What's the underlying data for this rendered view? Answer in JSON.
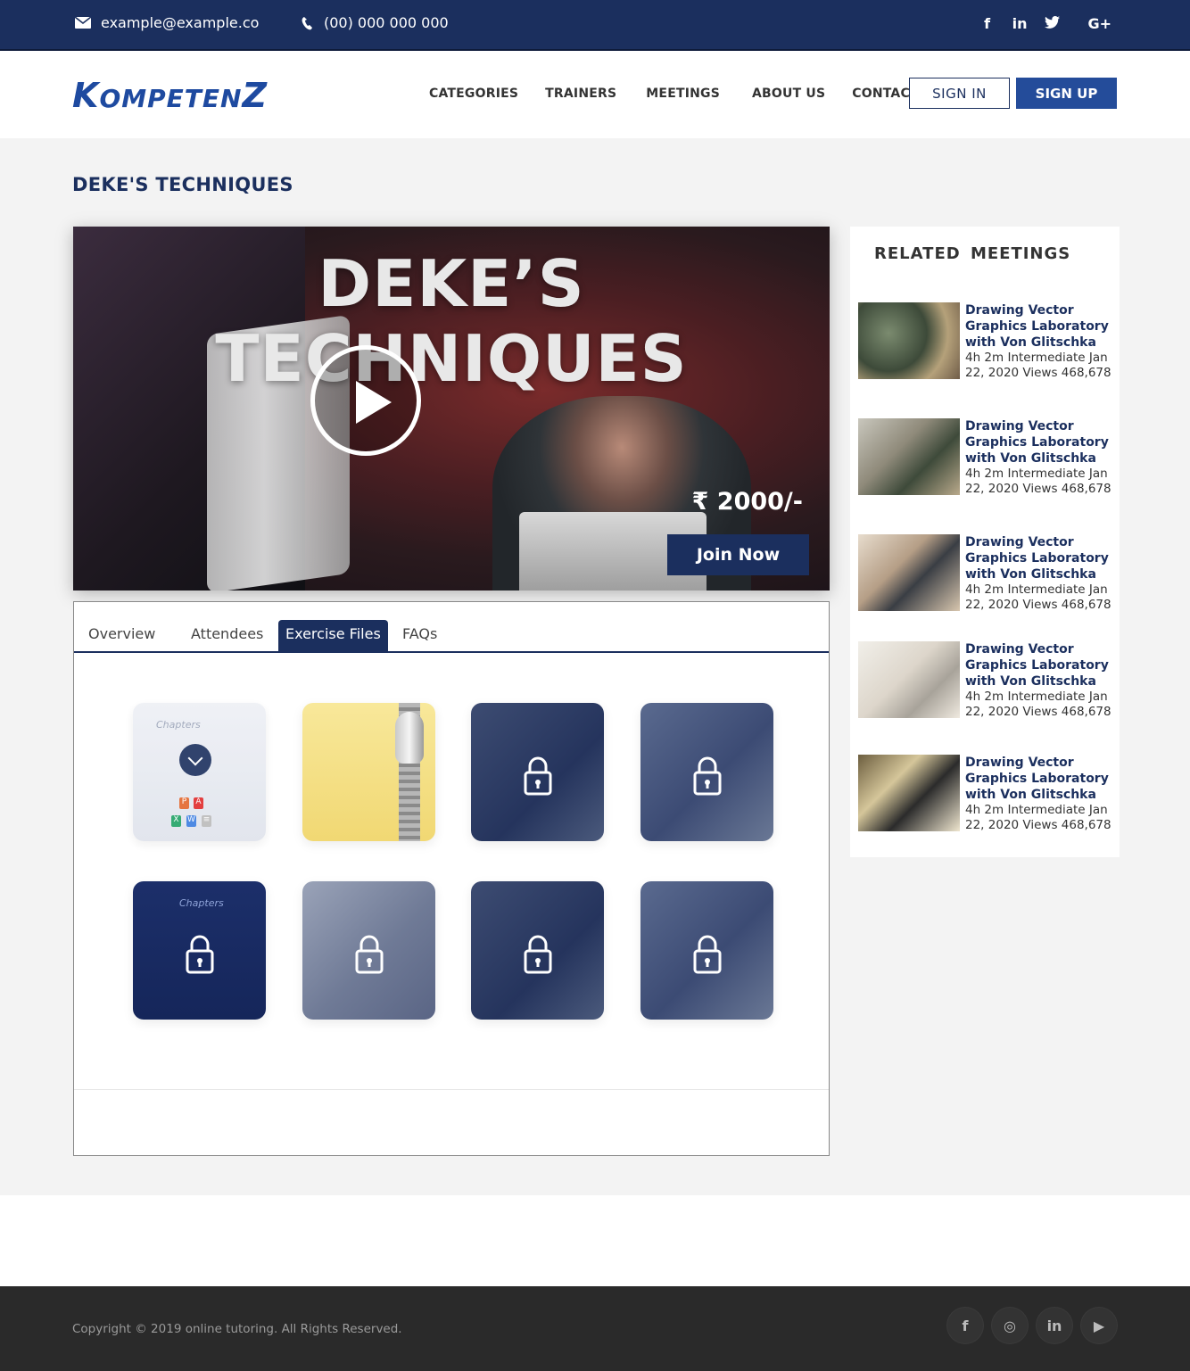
{
  "topbar": {
    "email": "example@example.co",
    "phone": "(00) 000 000 000",
    "socials": [
      "f",
      "in",
      "t",
      "G+"
    ]
  },
  "header": {
    "logo": {
      "k": "K",
      "ompeten": "OMPETEN",
      "z": "Z"
    },
    "nav": [
      "CATEGORIES",
      "TRAINERS",
      "MEETINGS",
      "ABOUT US",
      "CONTACT"
    ],
    "signin_label": "SIGN  IN",
    "signup_label": "SIGN UP"
  },
  "page": {
    "title": "DEKE'S TECHNIQUES"
  },
  "video": {
    "title": "DEKE’S TECHNIQUES",
    "price": "₹ 2000/-",
    "join_label": "Join Now"
  },
  "tabs": {
    "items": [
      "Overview",
      "Attendees",
      "Exercise Files",
      "FAQs"
    ],
    "active": "Exercise Files"
  },
  "exercise_files": {
    "chapters_label": "Chapters",
    "file_badges": [
      "P",
      "A",
      "X",
      "W",
      "≡"
    ]
  },
  "sidebar": {
    "title": "RELATED  MEETINGS",
    "items": [
      {
        "title": "Drawing Vector Graphics Laboratory with Von Glitschka",
        "meta": "4h 2m Intermediate Jan 22, 2020 Views 468,678"
      },
      {
        "title": "Drawing Vector Graphics Laboratory with Von Glitschka",
        "meta": "4h 2m Intermediate Jan 22, 2020 Views 468,678"
      },
      {
        "title": "Drawing Vector Graphics Laboratory with Von Glitschka",
        "meta": "4h 2m Intermediate Jan 22, 2020 Views 468,678"
      },
      {
        "title": "Drawing Vector Graphics Laboratory with Von Glitschka",
        "meta": "4h 2m Intermediate Jan 22, 2020 Views 468,678"
      },
      {
        "title": "Drawing Vector Graphics Laboratory with Von Glitschka",
        "meta": "4h 2m Intermediate Jan 22, 2020 Views 468,678"
      }
    ]
  },
  "footer": {
    "copyright": "Copyright © 2019 online tutoring. All Rights Reserved.",
    "socials": [
      "f",
      "◎",
      "in",
      "▶"
    ]
  },
  "colors": {
    "primary": "#1b2f5e",
    "accent": "#244c9a",
    "background": "#f3f3f3",
    "footer": "#2a2a2a"
  }
}
